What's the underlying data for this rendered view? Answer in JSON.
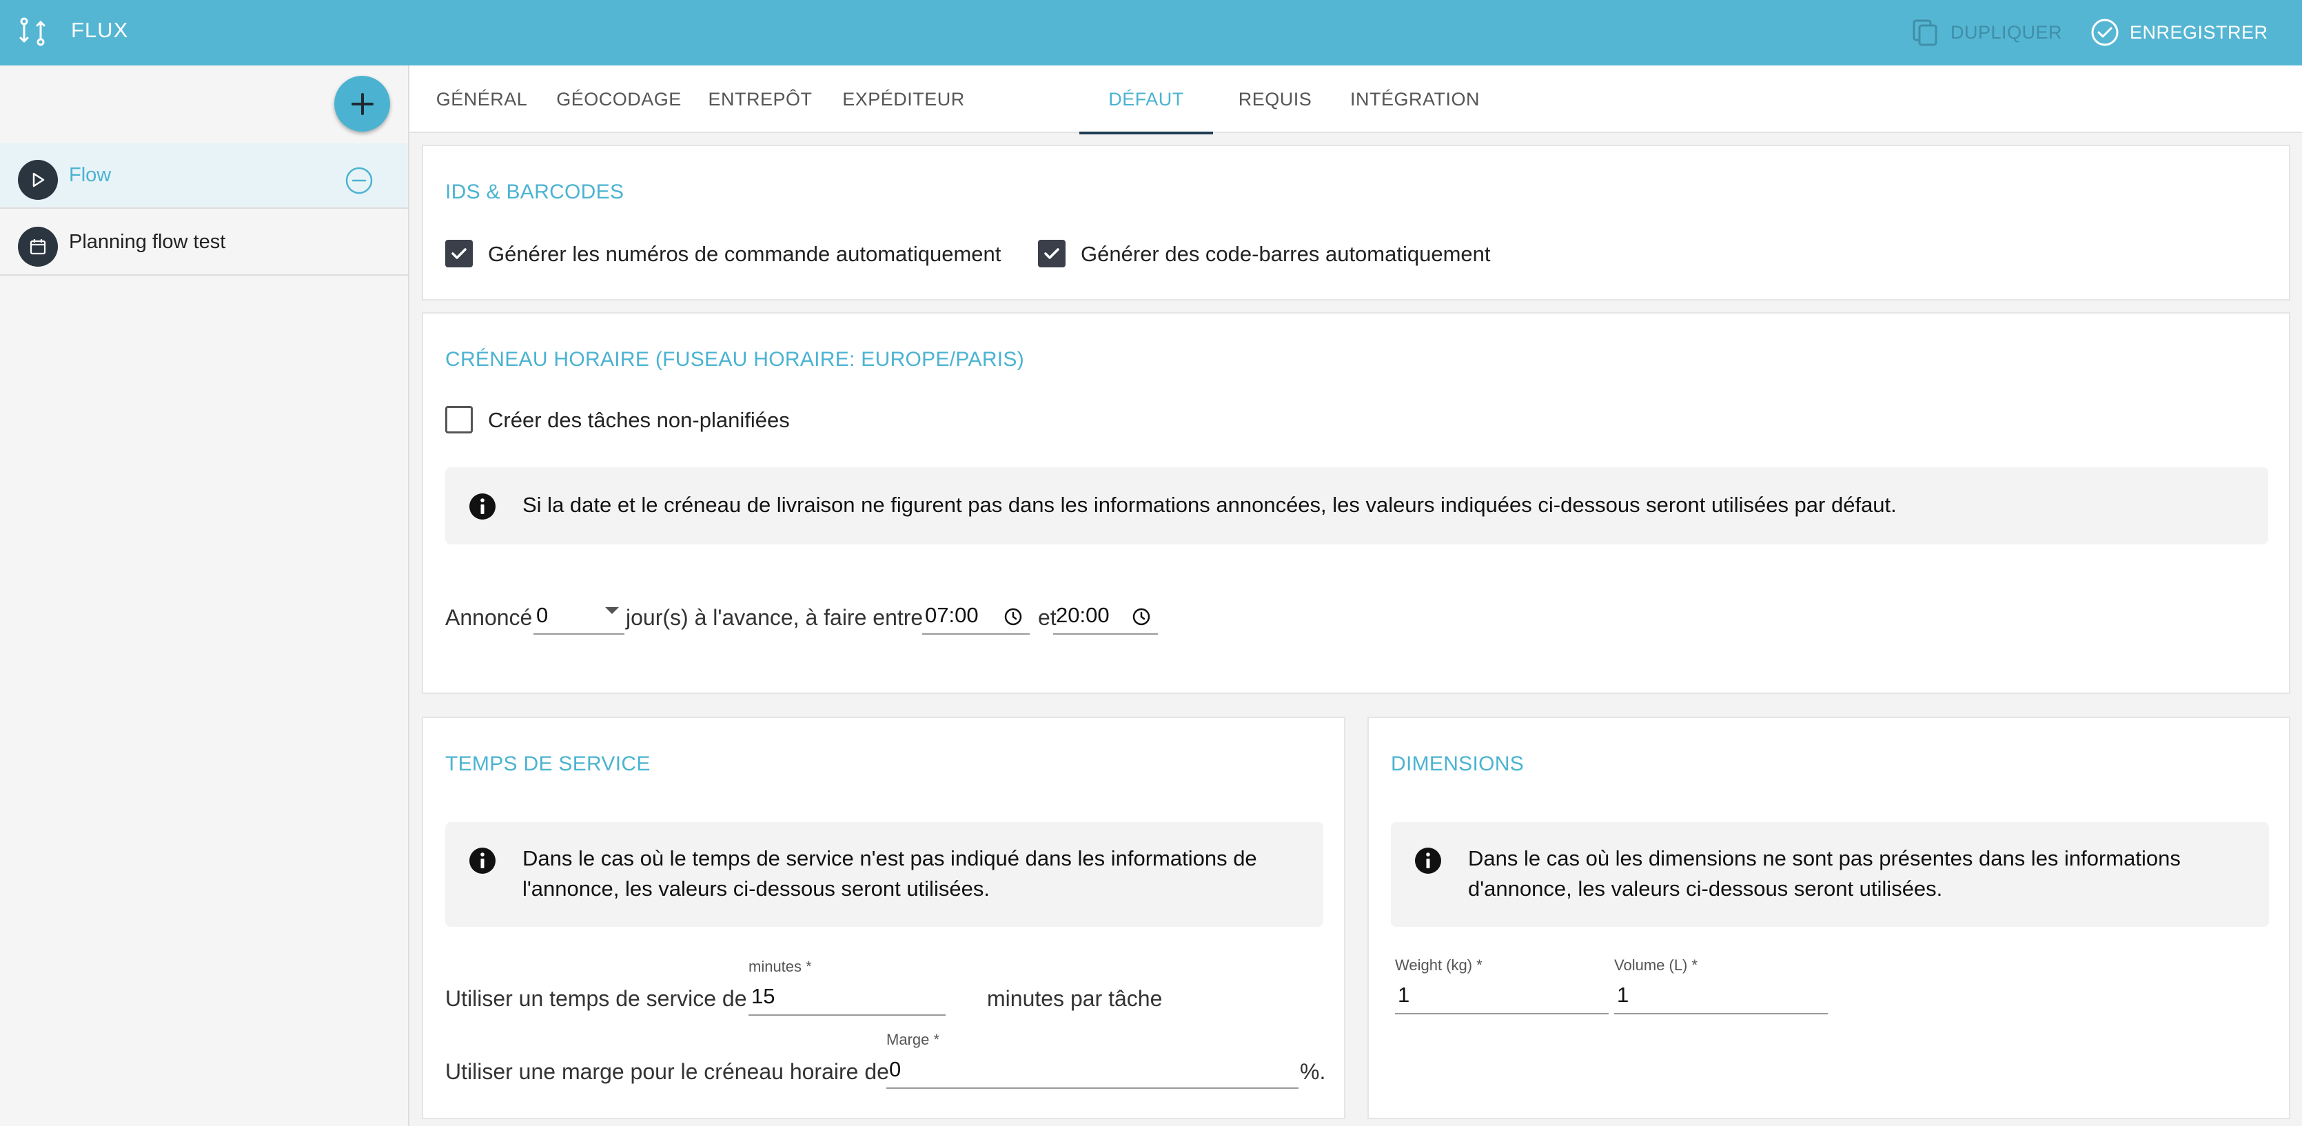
{
  "header": {
    "title": "FLUX",
    "duplicate_label": "DUPLIQUER",
    "save_label": "ENREGISTRER",
    "bg_color": "#55b6d3"
  },
  "sidebar": {
    "items": [
      {
        "label": "Flow",
        "icon": "play-icon",
        "active": true
      },
      {
        "label": "Planning flow test",
        "icon": "calendar-icon",
        "active": false
      }
    ]
  },
  "tabs": [
    {
      "label": "GÉNÉRAL"
    },
    {
      "label": "GÉOCODAGE"
    },
    {
      "label": "ENTREPÔT"
    },
    {
      "label": "EXPÉDITEUR"
    },
    {
      "label": "DÉFAUT",
      "active": true
    },
    {
      "label": "REQUIS"
    },
    {
      "label": "INTÉGRATION"
    }
  ],
  "ids": {
    "title": "IDS & BARCODES",
    "auto_order_label": "Générer les numéros de commande automatiquement",
    "auto_order_checked": true,
    "auto_barcode_label": "Générer des code-barres automatiquement",
    "auto_barcode_checked": true
  },
  "slot": {
    "title": "CRÉNEAU HORAIRE (FUSEAU HORAIRE: EUROPE/PARIS)",
    "unplanned_label": "Créer des tâches non-planifiées",
    "unplanned_checked": false,
    "info": "Si la date et le créneau de livraison ne figurent pas dans les informations annoncées, les valeurs indiquées ci-dessous seront utilisées par défaut.",
    "announced_prefix": "Annoncé",
    "days_value": "0",
    "days_suffix": "jour(s) à l'avance, à faire entre",
    "from_time": "07:00",
    "and_label": "et",
    "to_time": "20:00"
  },
  "service": {
    "title": "TEMPS DE SERVICE",
    "info": "Dans le cas où le temps de service n'est pas indiqué dans les informations de l'annonce, les valeurs ci-dessous seront utilisées.",
    "service_prefix": "Utiliser un temps de service de",
    "minutes_label": "minutes *",
    "minutes_value": "15",
    "service_suffix": "minutes par tâche",
    "margin_prefix": "Utiliser une marge pour le créneau horaire de",
    "margin_label": "Marge *",
    "margin_value": "0",
    "margin_suffix": "%."
  },
  "dimensions": {
    "title": "DIMENSIONS",
    "info": "Dans le cas où les dimensions ne sont pas présentes dans les informations d'annonce, les valeurs ci-dessous seront utilisées.",
    "weight_label": "Weight (kg) *",
    "weight_value": "1",
    "volume_label": "Volume (L) *",
    "volume_value": "1"
  }
}
